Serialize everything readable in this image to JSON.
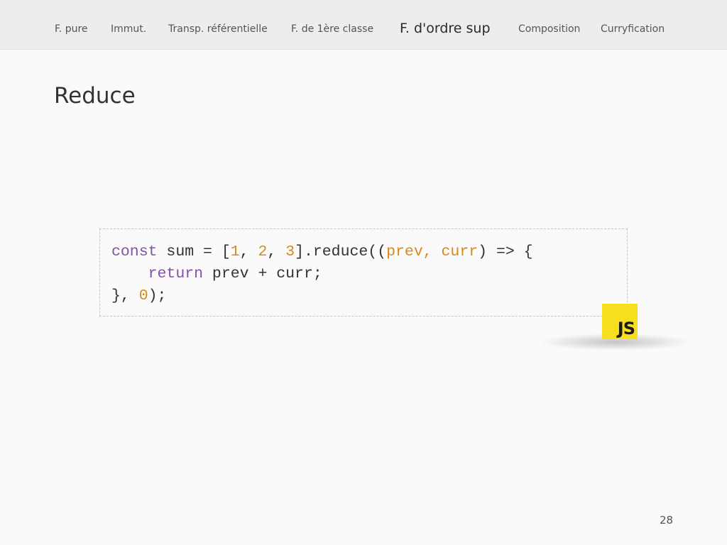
{
  "nav": {
    "items": [
      {
        "label": "F. pure",
        "active": false
      },
      {
        "label": "Immut.",
        "active": false
      },
      {
        "label": "Transp. référentielle",
        "active": false
      },
      {
        "label": "F. de 1ère classe",
        "active": false
      },
      {
        "label": "F. d'ordre sup",
        "active": true
      },
      {
        "label": "Composition",
        "active": false
      },
      {
        "label": "Curryfication",
        "active": false
      }
    ]
  },
  "slide": {
    "title": "Reduce",
    "page_number": "28"
  },
  "code": {
    "language_badge": "JS",
    "lines": [
      [
        {
          "text": "const",
          "kind": "keyword"
        },
        {
          "text": " sum = [",
          "kind": "plain"
        },
        {
          "text": "1",
          "kind": "number"
        },
        {
          "text": ", ",
          "kind": "plain"
        },
        {
          "text": "2",
          "kind": "number"
        },
        {
          "text": ", ",
          "kind": "plain"
        },
        {
          "text": "3",
          "kind": "number"
        },
        {
          "text": "].reduce((",
          "kind": "plain"
        },
        {
          "text": "prev, curr",
          "kind": "param"
        },
        {
          "text": ") => {",
          "kind": "plain"
        }
      ],
      [
        {
          "text": "    ",
          "kind": "plain"
        },
        {
          "text": "return",
          "kind": "keyword"
        },
        {
          "text": " prev + curr;",
          "kind": "plain"
        }
      ],
      [
        {
          "text": "}, ",
          "kind": "plain"
        },
        {
          "text": "0",
          "kind": "number"
        },
        {
          "text": ");",
          "kind": "plain"
        }
      ]
    ]
  },
  "colors": {
    "keyword": "#8452a8",
    "number": "#d98a1c",
    "js_badge": "#f7df1e"
  }
}
